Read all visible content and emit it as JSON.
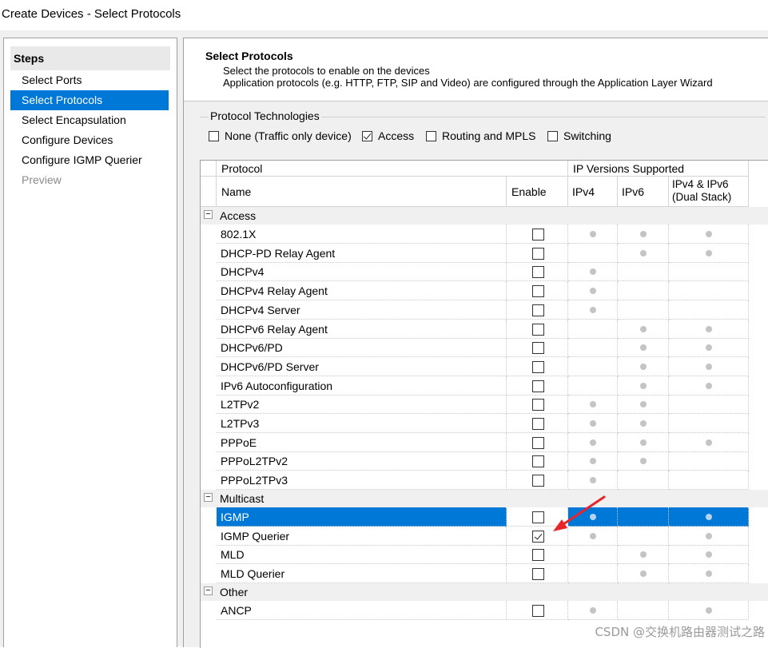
{
  "window": {
    "title": "Create Devices - Select Protocols"
  },
  "steps": {
    "header": "Steps",
    "items": [
      {
        "label": "Select Ports",
        "state": "normal"
      },
      {
        "label": "Select Protocols",
        "state": "selected"
      },
      {
        "label": "Select Encapsulation",
        "state": "normal"
      },
      {
        "label": "Configure Devices",
        "state": "normal"
      },
      {
        "label": "Configure IGMP Querier",
        "state": "normal"
      },
      {
        "label": "Preview",
        "state": "disabled"
      }
    ]
  },
  "header": {
    "title": "Select Protocols",
    "line1": "Select the protocols to enable on the devices",
    "line2": "Application protocols (e.g. HTTP, FTP, SIP and Video) are configured through the Application Layer Wizard"
  },
  "technologies": {
    "legend": "Protocol Technologies",
    "options": [
      {
        "label": "None (Traffic only device)",
        "checked": false
      },
      {
        "label": "Access",
        "checked": true
      },
      {
        "label": "Routing and MPLS",
        "checked": false
      },
      {
        "label": "Switching",
        "checked": false
      }
    ]
  },
  "grid": {
    "header_protocol": "Protocol",
    "header_ipversions": "IP Versions Supported",
    "col_name": "Name",
    "col_enable": "Enable",
    "col_ipv4": "IPv4",
    "col_ipv6": "IPv6",
    "col_dual_line1": "IPv4 & IPv6",
    "col_dual_line2": "(Dual Stack)",
    "groups": [
      {
        "name": "Access",
        "rows": [
          {
            "name": "802.1X",
            "enabled": false,
            "ipv4": true,
            "ipv6": true,
            "dual": true
          },
          {
            "name": "DHCP-PD Relay Agent",
            "enabled": false,
            "ipv4": false,
            "ipv6": true,
            "dual": true
          },
          {
            "name": "DHCPv4",
            "enabled": false,
            "ipv4": true,
            "ipv6": false,
            "dual": false
          },
          {
            "name": "DHCPv4 Relay Agent",
            "enabled": false,
            "ipv4": true,
            "ipv6": false,
            "dual": false
          },
          {
            "name": "DHCPv4 Server",
            "enabled": false,
            "ipv4": true,
            "ipv6": false,
            "dual": false
          },
          {
            "name": "DHCPv6 Relay Agent",
            "enabled": false,
            "ipv4": false,
            "ipv6": true,
            "dual": true
          },
          {
            "name": "DHCPv6/PD",
            "enabled": false,
            "ipv4": false,
            "ipv6": true,
            "dual": true
          },
          {
            "name": "DHCPv6/PD Server",
            "enabled": false,
            "ipv4": false,
            "ipv6": true,
            "dual": true
          },
          {
            "name": "IPv6 Autoconfiguration",
            "enabled": false,
            "ipv4": false,
            "ipv6": true,
            "dual": true
          },
          {
            "name": "L2TPv2",
            "enabled": false,
            "ipv4": true,
            "ipv6": true,
            "dual": false
          },
          {
            "name": "L2TPv3",
            "enabled": false,
            "ipv4": true,
            "ipv6": true,
            "dual": false
          },
          {
            "name": "PPPoE",
            "enabled": false,
            "ipv4": true,
            "ipv6": true,
            "dual": true
          },
          {
            "name": "PPPoL2TPv2",
            "enabled": false,
            "ipv4": true,
            "ipv6": true,
            "dual": false
          },
          {
            "name": "PPPoL2TPv3",
            "enabled": false,
            "ipv4": true,
            "ipv6": false,
            "dual": false
          }
        ]
      },
      {
        "name": "Multicast",
        "rows": [
          {
            "name": "IGMP",
            "enabled": false,
            "ipv4": true,
            "ipv6": false,
            "dual": true,
            "selected": true
          },
          {
            "name": "IGMP Querier",
            "enabled": true,
            "ipv4": true,
            "ipv6": false,
            "dual": true
          },
          {
            "name": "MLD",
            "enabled": false,
            "ipv4": false,
            "ipv6": true,
            "dual": true
          },
          {
            "name": "MLD Querier",
            "enabled": false,
            "ipv4": false,
            "ipv6": true,
            "dual": true
          }
        ]
      },
      {
        "name": "Other",
        "rows": [
          {
            "name": "ANCP",
            "enabled": false,
            "ipv4": true,
            "ipv6": false,
            "dual": true
          }
        ]
      }
    ]
  },
  "annotation": {
    "color": "#e8262a",
    "icon": "arrow-icon"
  },
  "watermark": "CSDN @交换机路由器测试之路",
  "colors": {
    "selection": "#0078d7",
    "dot": "#c4c4c4"
  }
}
